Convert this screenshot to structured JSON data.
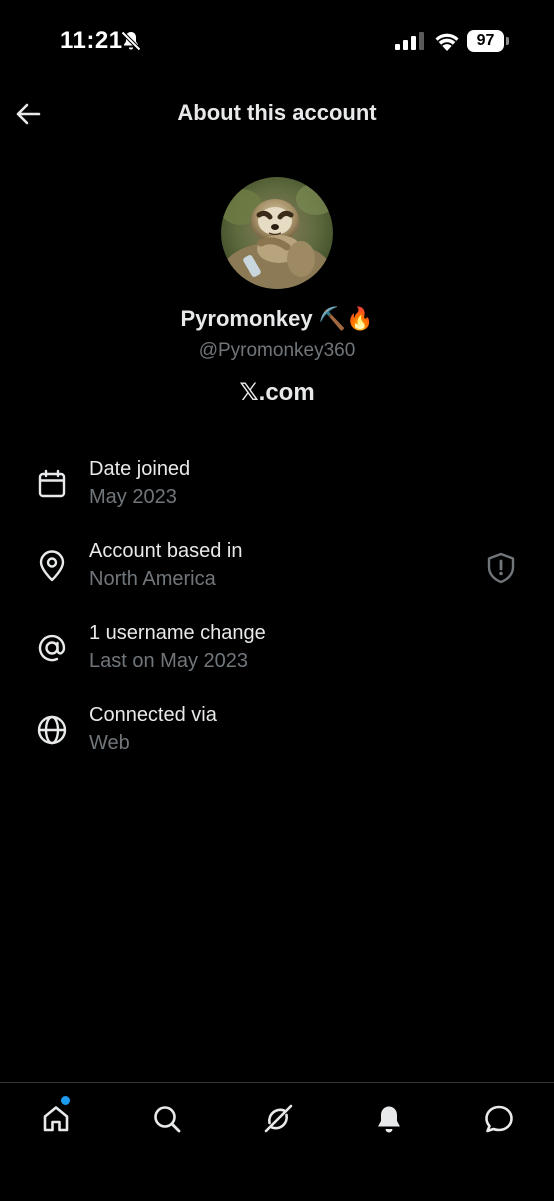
{
  "status_bar": {
    "time": "11:21",
    "battery": "97"
  },
  "header": {
    "title": "About this account"
  },
  "profile": {
    "display_name": "Pyromonkey ⛏️🔥",
    "handle": "@Pyromonkey360",
    "platform": "𝕏.com"
  },
  "info_rows": [
    {
      "icon": "calendar-icon",
      "title": "Date joined",
      "subtitle": "May 2023"
    },
    {
      "icon": "location-pin-icon",
      "title": "Account based in",
      "subtitle": "North America"
    },
    {
      "icon": "at-sign-icon",
      "title": "1 username change",
      "subtitle": "Last on May 2023"
    },
    {
      "icon": "globe-icon",
      "title": "Connected via",
      "subtitle": "Web"
    }
  ],
  "bottom_nav": {
    "items": [
      "home-icon",
      "search-icon",
      "grok-icon",
      "notifications-icon",
      "messages-icon"
    ]
  },
  "colors": {
    "background": "#000000",
    "primary_text": "#e7e9ea",
    "secondary_text": "#71767b",
    "accent": "#1d9bf0"
  }
}
